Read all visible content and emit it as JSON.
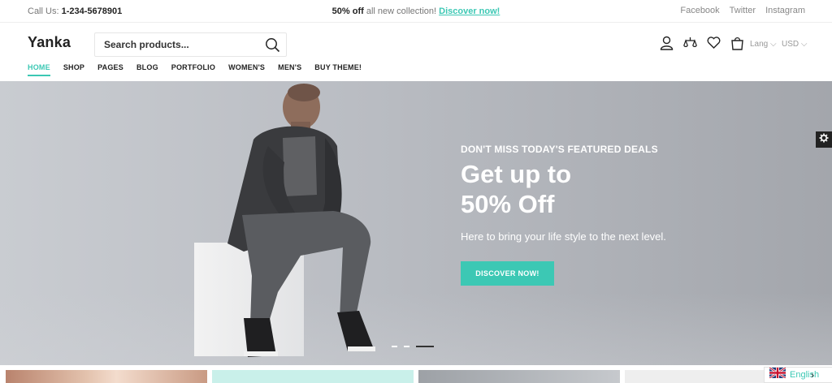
{
  "topbar": {
    "call_prefix": "Call Us:",
    "phone": "1-234-5678901",
    "promo_bold": "50% off",
    "promo_text": "all new collection!",
    "promo_link": "Discover now!",
    "social": [
      "Facebook",
      "Twitter",
      "Instagram"
    ]
  },
  "header": {
    "logo": "Yanka",
    "search_placeholder": "Search products...",
    "lang": "Lang",
    "currency": "USD",
    "icons": [
      "account-icon",
      "compare-icon",
      "wishlist-icon",
      "cart-icon"
    ]
  },
  "nav": [
    "HOME",
    "SHOP",
    "PAGES",
    "BLOG",
    "PORTFOLIO",
    "WOMEN'S",
    "MEN'S",
    "BUY THEME!"
  ],
  "hero": {
    "kicker": "DON'T MISS TODAY'S FEATURED DEALS",
    "title_line1": "Get up to",
    "title_line2": "50% Off",
    "subtitle": "Here to bring your life style to the next level.",
    "button": "DISCOVER NOW!",
    "active_slide": 3,
    "slide_count": 3
  },
  "language_switcher": {
    "label": "English"
  },
  "colors": {
    "accent": "#3cc8b4",
    "text": "#222222",
    "muted": "#777777"
  }
}
